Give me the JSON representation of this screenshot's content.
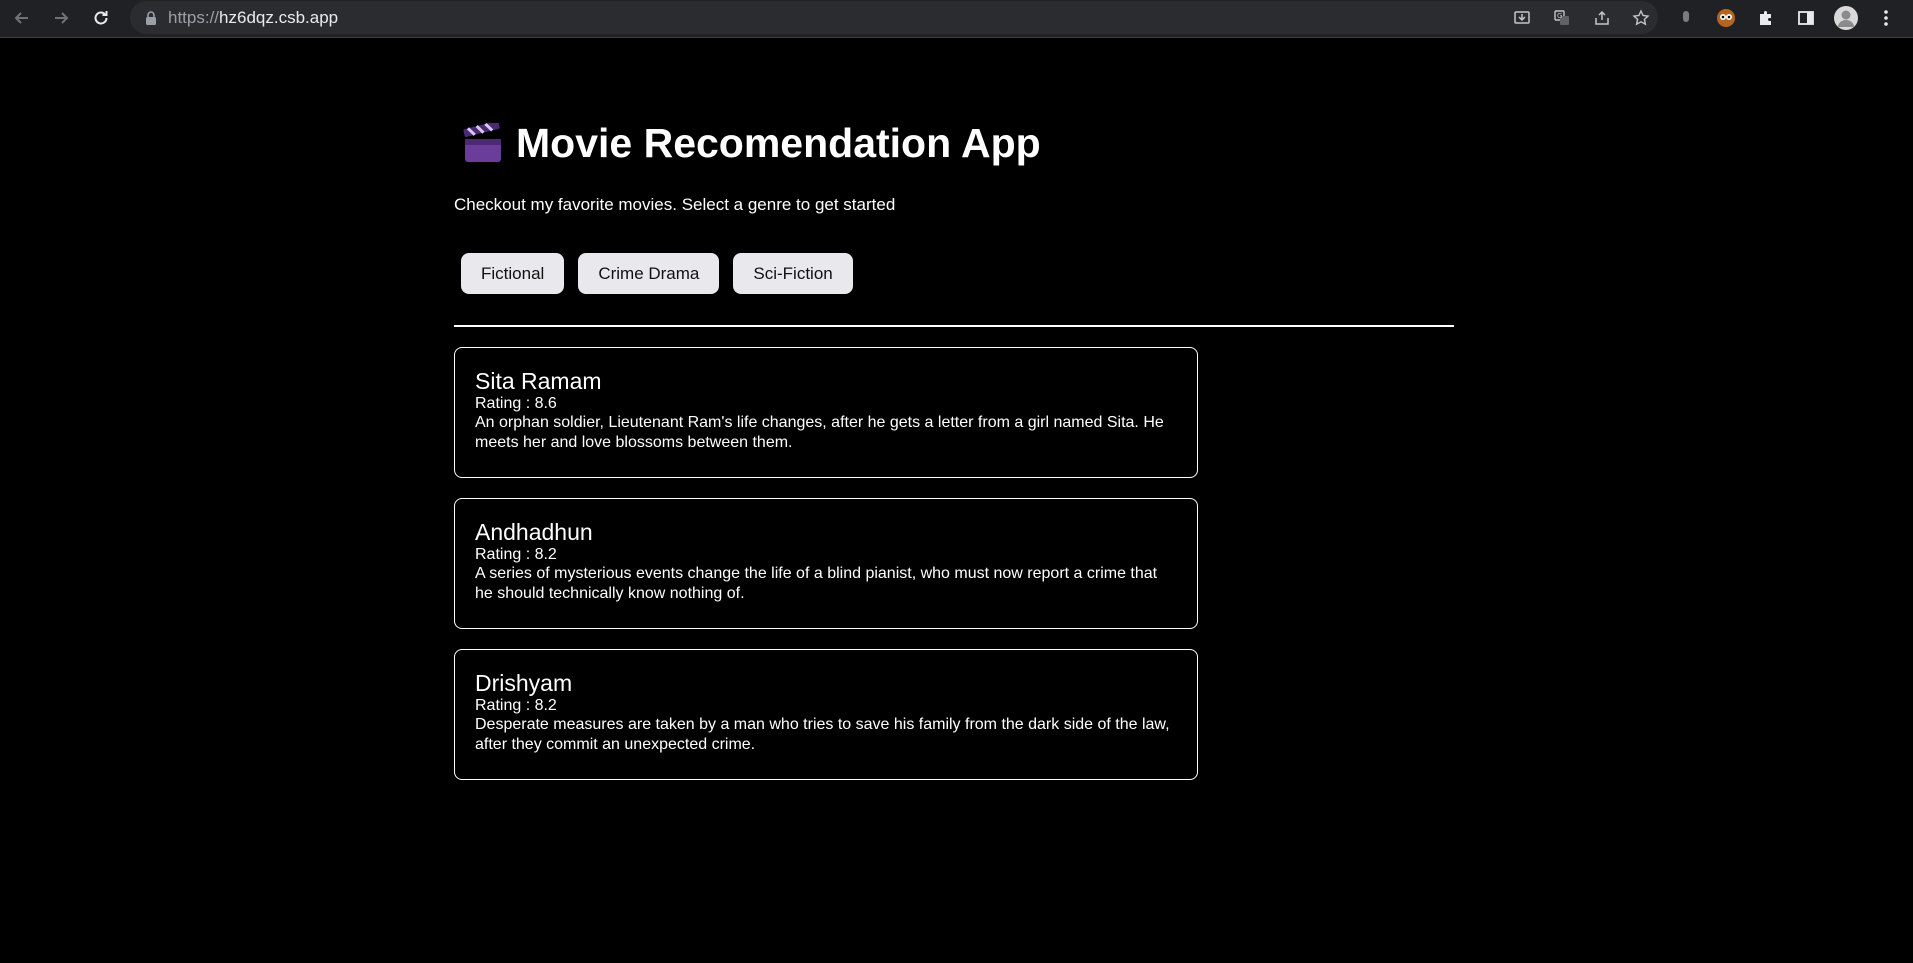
{
  "browser": {
    "url_scheme": "https://",
    "url_host": "hz6dqz.csb.app"
  },
  "header": {
    "icon": "clapper-board-icon",
    "title": "Movie Recomendation App",
    "subtitle": "Checkout my favorite movies. Select a genre to get started"
  },
  "genres": [
    {
      "label": "Fictional"
    },
    {
      "label": "Crime Drama"
    },
    {
      "label": "Sci-Fiction"
    }
  ],
  "movies": [
    {
      "name": "Sita Ramam",
      "rating": "Rating : 8.6",
      "description": "An orphan soldier, Lieutenant Ram's life changes, after he gets a letter from a girl named Sita. He meets her and love blossoms between them."
    },
    {
      "name": "Andhadhun",
      "rating": "Rating : 8.2",
      "description": "A series of mysterious events change the life of a blind pianist, who must now report a crime that he should technically know nothing of."
    },
    {
      "name": "Drishyam",
      "rating": "Rating : 8.2",
      "description": "Desperate measures are taken by a man who tries to save his family from the dark side of the law, after they commit an unexpected crime."
    }
  ],
  "colors": {
    "background": "#000000",
    "text": "#ffffff",
    "button_bg": "#e9e9ed",
    "browser_bar": "#202124"
  }
}
